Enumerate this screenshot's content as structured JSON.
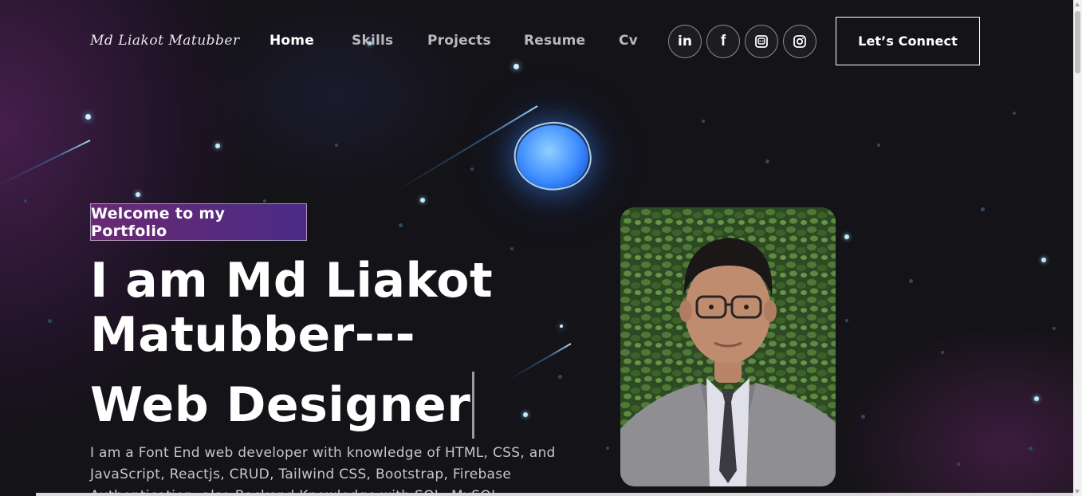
{
  "nav": {
    "logo": "Md Liakot Matubber",
    "links": [
      {
        "label": "Home",
        "active": true
      },
      {
        "label": "Skills",
        "active": false
      },
      {
        "label": "Projects",
        "active": false
      },
      {
        "label": "Resume",
        "active": false
      },
      {
        "label": "Cv",
        "active": false
      }
    ],
    "social": [
      {
        "icon": "linkedin-icon",
        "glyph": "in"
      },
      {
        "icon": "facebook-icon",
        "glyph": "f"
      },
      {
        "icon": "discord-icon",
        "glyph": ""
      },
      {
        "icon": "instagram-icon",
        "glyph": ""
      }
    ],
    "connect_label": "Let’s Connect"
  },
  "hero": {
    "tagline": "Welcome to my Portfolio",
    "title_line1": "I am Md Liakot",
    "title_line2": "Matubber---",
    "rotating_text": "Web Designer",
    "description": "I am a Font End web developer with knowledge of HTML, CSS, and JavaScript, Reactjs, CRUD, Tailwind CSS, Bootstrap, Firebase Authentication, also Backend Knowledge with SQL, MySQL"
  },
  "colors": {
    "background": "#121212",
    "tagline_gradient_start": "#6a2a73",
    "tagline_gradient_end": "#4a2b86",
    "planet": "#3d8cff",
    "star": "#bfeaff"
  }
}
